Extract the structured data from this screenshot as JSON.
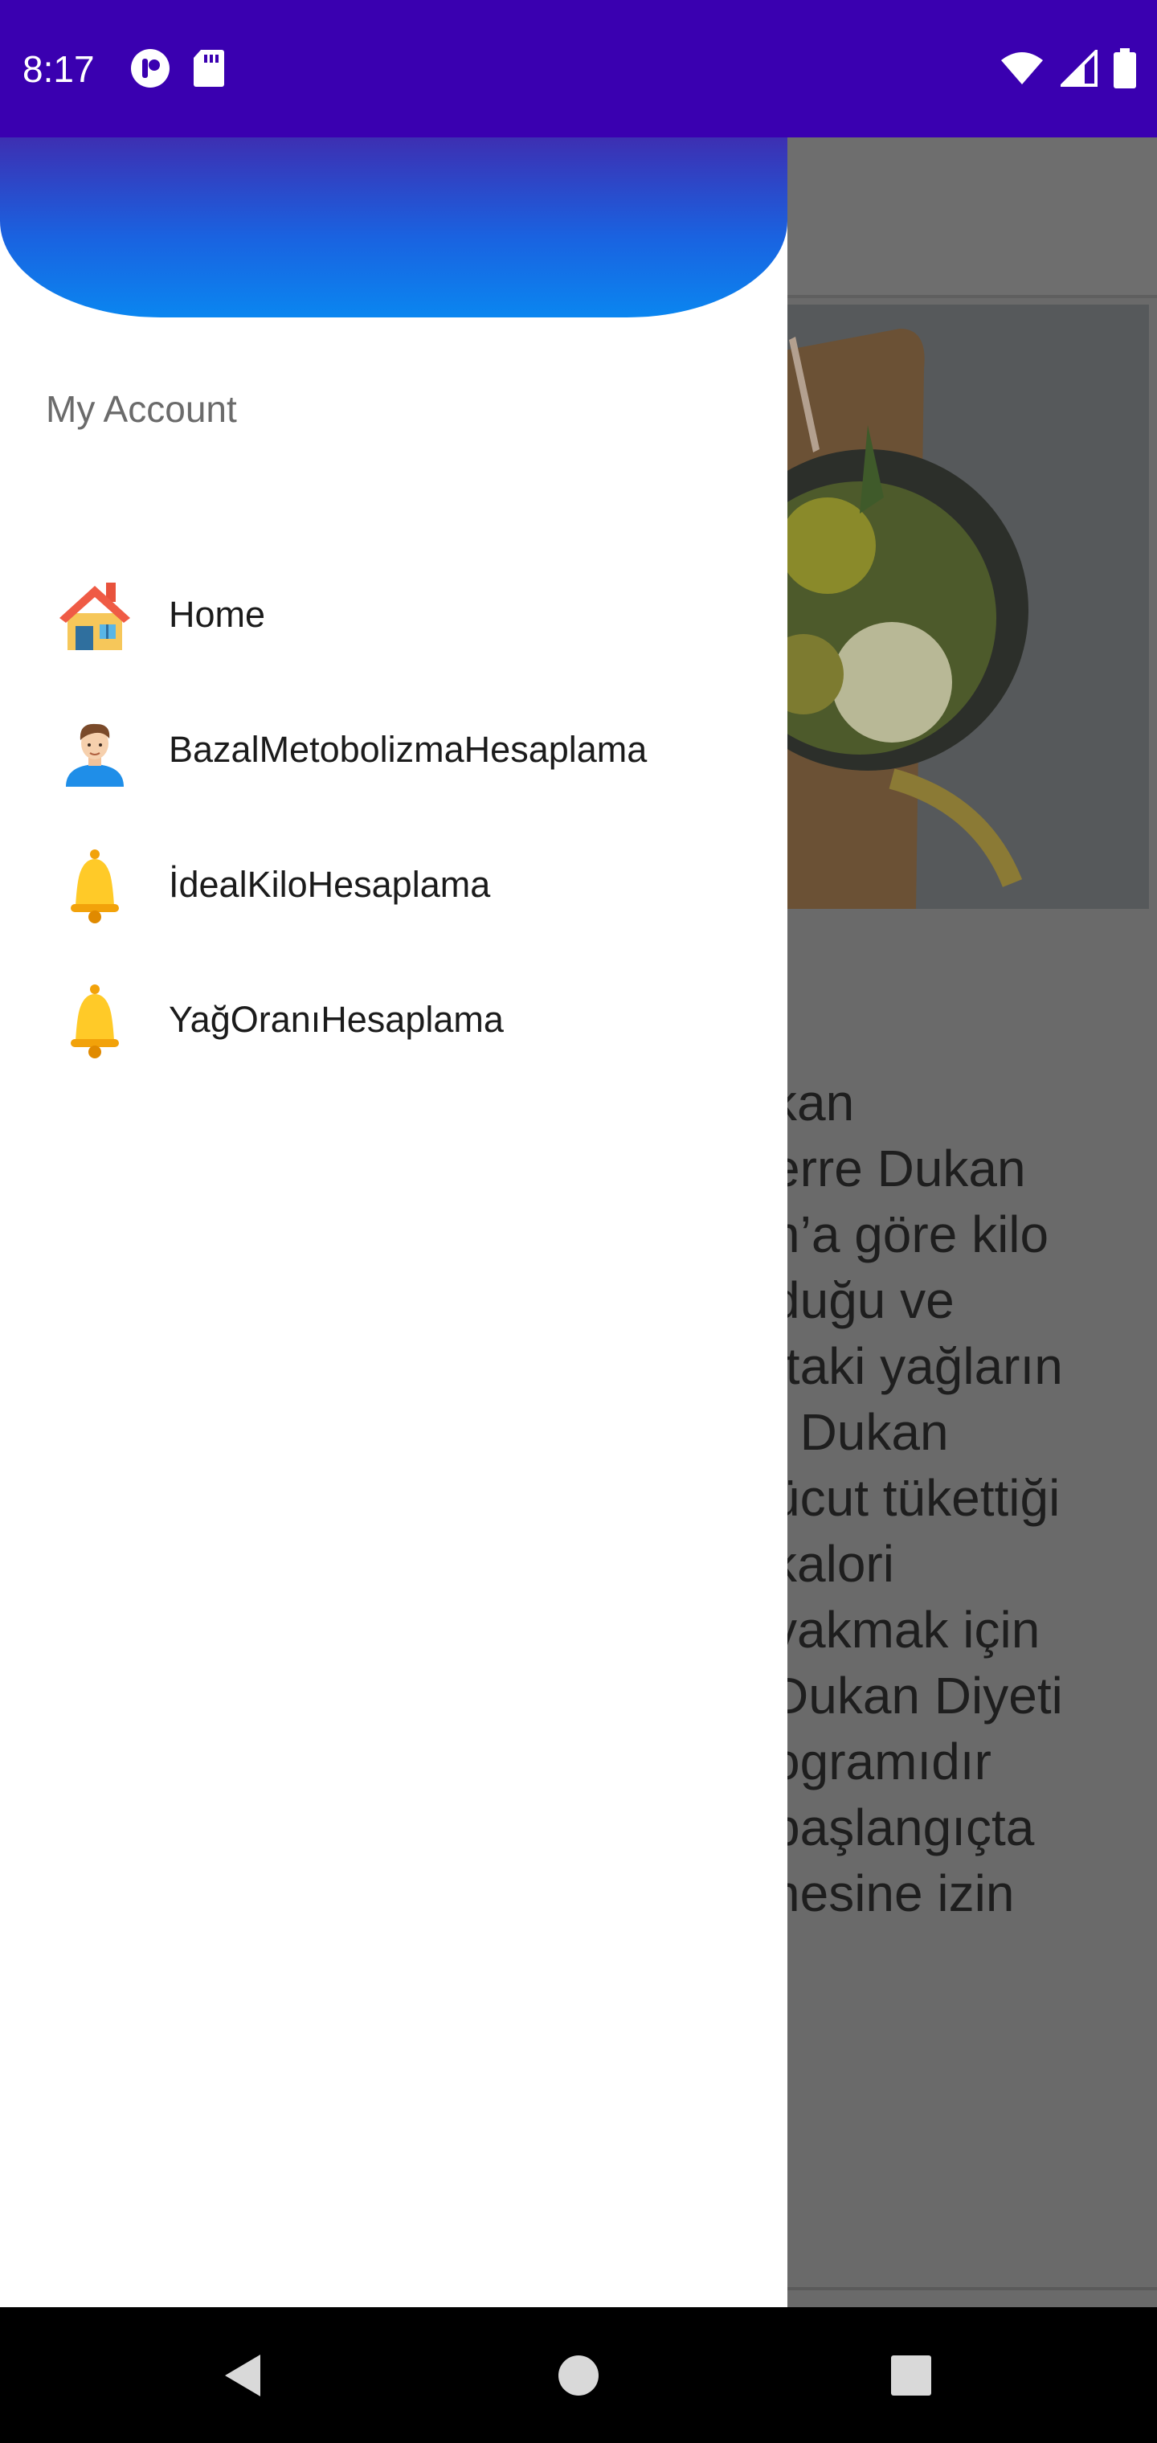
{
  "status_bar": {
    "time": "8:17",
    "left_icons": [
      "circle-logo-icon",
      "sd-card-icon"
    ],
    "right_icons": [
      "wifi-icon",
      "signal-icon",
      "battery-icon"
    ]
  },
  "drawer": {
    "section_title": "My Account",
    "items": [
      {
        "label": "Home",
        "icon": "house-icon"
      },
      {
        "label": "BazalMetobolizmaHesaplama",
        "icon": "man-avatar-icon"
      },
      {
        "label": "İdealKiloHesaplama",
        "icon": "bell-icon"
      },
      {
        "label": "YağOranıHesaplama",
        "icon": "bell-icon"
      }
    ]
  },
  "background_content": {
    "text_lines": [
      "kan",
      "erre Dukan",
      "n’a göre kilo",
      "duğu ve",
      "ttaki yağların",
      ". Dukan",
      "ücut tükettiği",
      " kalori",
      " yakmak için",
      " Dukan Diyeti",
      "ogramıdır",
      "başlangıçta",
      "nesine izin"
    ]
  },
  "nav_bar": {
    "buttons": [
      "back-icon",
      "home-icon",
      "recents-icon"
    ]
  },
  "colors": {
    "status_bar": "#3a00b0",
    "header_gradient_top": "#3d2fb2",
    "header_gradient_bottom": "#0a86f0",
    "scrim": "#6a6a6a"
  }
}
